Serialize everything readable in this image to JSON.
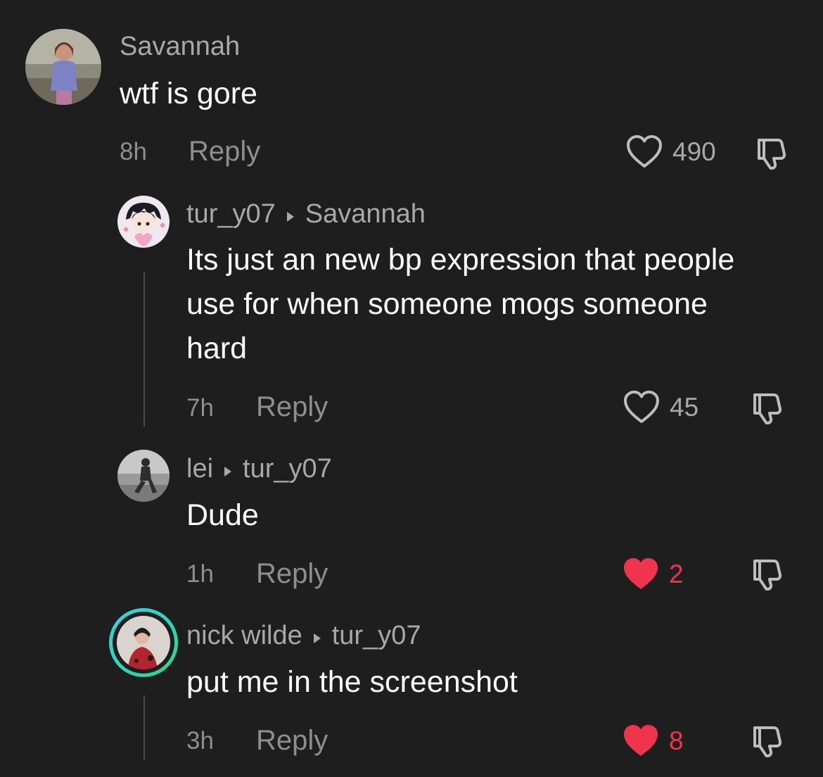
{
  "comments": [
    {
      "username": "Savannah",
      "reply_to": "",
      "text": "wtf is gore",
      "time": "8h",
      "reply_label": "Reply",
      "likes": "490",
      "liked": false
    },
    {
      "username": "tur_y07",
      "reply_to": "Savannah",
      "text": "Its just an new bp expression that people use for when someone mogs someone hard",
      "time": "7h",
      "reply_label": "Reply",
      "likes": "45",
      "liked": false
    },
    {
      "username": "lei",
      "reply_to": "tur_y07",
      "text": "Dude",
      "time": "1h",
      "reply_label": "Reply",
      "likes": "2",
      "liked": true
    },
    {
      "username": "nick wilde",
      "reply_to": "tur_y07",
      "text": "put me in the screenshot",
      "time": "3h",
      "reply_label": "Reply",
      "likes": "8",
      "liked": true
    }
  ],
  "colors": {
    "background": "#1e1e1e",
    "liked": "#f0344e",
    "muted": "#8e8e8e",
    "story_ring_start": "#3ad1e0",
    "story_ring_end": "#2bd58f"
  }
}
